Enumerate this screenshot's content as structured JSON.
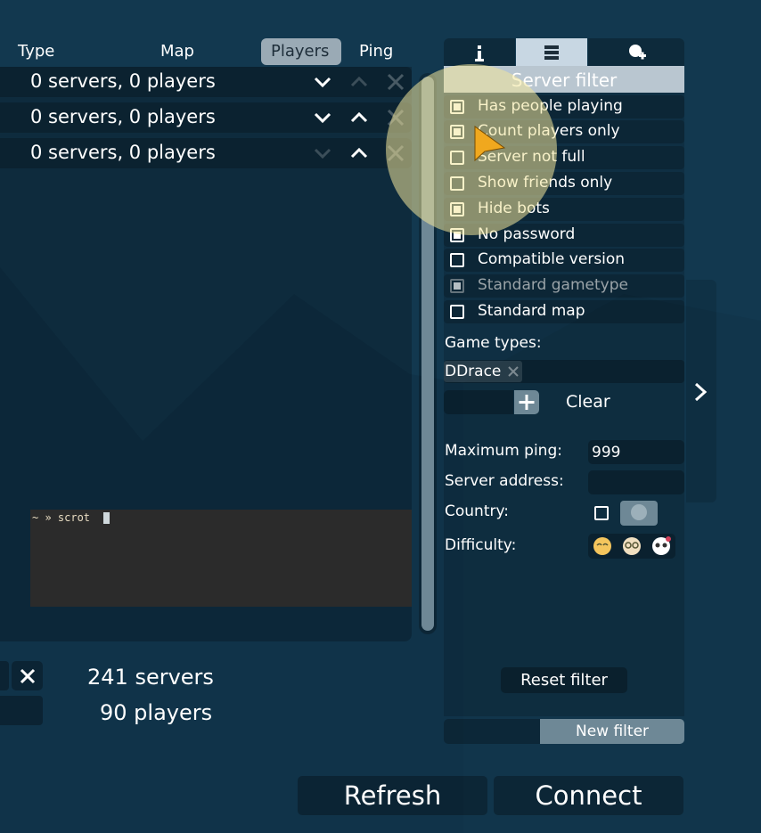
{
  "columns": [
    "Type",
    "Map",
    "Players",
    "Ping"
  ],
  "filter_rows": [
    {
      "label": "0 servers, 0 players"
    },
    {
      "label": "0 servers, 0 players"
    },
    {
      "label": "0 servers, 0 players"
    }
  ],
  "terminal": {
    "prompt": "~ » scrot "
  },
  "stats": {
    "servers": "241 servers",
    "players": "90 players"
  },
  "tabs": {
    "info_icon": "info-icon",
    "server_icon": "server-list-icon",
    "friends_icon": "friends-icon"
  },
  "filter": {
    "title": "Server filter",
    "options": [
      {
        "label": "Has people playing",
        "checked": true
      },
      {
        "label": "Count players only",
        "checked": true
      },
      {
        "label": "Server not full",
        "checked": false
      },
      {
        "label": "Show friends only",
        "checked": false
      },
      {
        "label": "Hide bots",
        "checked": true
      },
      {
        "label": "No password",
        "checked": true
      },
      {
        "label": "Compatible version",
        "checked": false
      },
      {
        "label": "Standard gametype",
        "checked": true,
        "disabled": true
      },
      {
        "label": "Standard map",
        "checked": false
      }
    ],
    "game_types_label": "Game types:",
    "game_type_tag": "DDrace",
    "clear_label": "Clear",
    "max_ping_label": "Maximum ping:",
    "max_ping_value": "999",
    "server_address_label": "Server address:",
    "server_address_value": "",
    "country_label": "Country:",
    "difficulty_label": "Difficulty:",
    "reset_label": "Reset filter",
    "new_filter_label": "New filter"
  },
  "buttons": {
    "refresh": "Refresh",
    "connect": "Connect"
  },
  "colors": {
    "background": "#12384f",
    "active_tab": "#c8d7e3",
    "title_bar": "#b9c6d0",
    "accent_highlight": "#f2e59a"
  }
}
